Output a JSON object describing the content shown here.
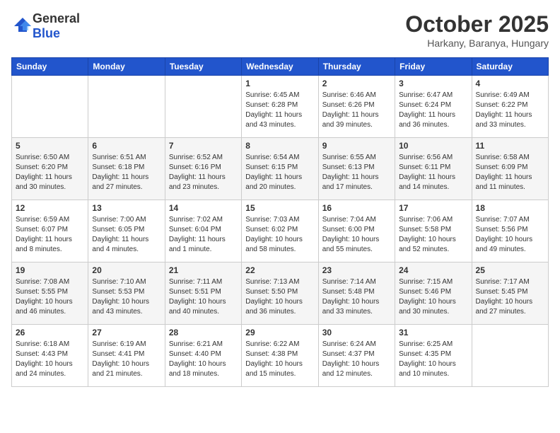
{
  "logo": {
    "general": "General",
    "blue": "Blue"
  },
  "header": {
    "title": "October 2025",
    "subtitle": "Harkany, Baranya, Hungary"
  },
  "weekdays": [
    "Sunday",
    "Monday",
    "Tuesday",
    "Wednesday",
    "Thursday",
    "Friday",
    "Saturday"
  ],
  "weeks": [
    [
      {
        "day": "",
        "info": ""
      },
      {
        "day": "",
        "info": ""
      },
      {
        "day": "",
        "info": ""
      },
      {
        "day": "1",
        "info": "Sunrise: 6:45 AM\nSunset: 6:28 PM\nDaylight: 11 hours\nand 43 minutes."
      },
      {
        "day": "2",
        "info": "Sunrise: 6:46 AM\nSunset: 6:26 PM\nDaylight: 11 hours\nand 39 minutes."
      },
      {
        "day": "3",
        "info": "Sunrise: 6:47 AM\nSunset: 6:24 PM\nDaylight: 11 hours\nand 36 minutes."
      },
      {
        "day": "4",
        "info": "Sunrise: 6:49 AM\nSunset: 6:22 PM\nDaylight: 11 hours\nand 33 minutes."
      }
    ],
    [
      {
        "day": "5",
        "info": "Sunrise: 6:50 AM\nSunset: 6:20 PM\nDaylight: 11 hours\nand 30 minutes."
      },
      {
        "day": "6",
        "info": "Sunrise: 6:51 AM\nSunset: 6:18 PM\nDaylight: 11 hours\nand 27 minutes."
      },
      {
        "day": "7",
        "info": "Sunrise: 6:52 AM\nSunset: 6:16 PM\nDaylight: 11 hours\nand 23 minutes."
      },
      {
        "day": "8",
        "info": "Sunrise: 6:54 AM\nSunset: 6:15 PM\nDaylight: 11 hours\nand 20 minutes."
      },
      {
        "day": "9",
        "info": "Sunrise: 6:55 AM\nSunset: 6:13 PM\nDaylight: 11 hours\nand 17 minutes."
      },
      {
        "day": "10",
        "info": "Sunrise: 6:56 AM\nSunset: 6:11 PM\nDaylight: 11 hours\nand 14 minutes."
      },
      {
        "day": "11",
        "info": "Sunrise: 6:58 AM\nSunset: 6:09 PM\nDaylight: 11 hours\nand 11 minutes."
      }
    ],
    [
      {
        "day": "12",
        "info": "Sunrise: 6:59 AM\nSunset: 6:07 PM\nDaylight: 11 hours\nand 8 minutes."
      },
      {
        "day": "13",
        "info": "Sunrise: 7:00 AM\nSunset: 6:05 PM\nDaylight: 11 hours\nand 4 minutes."
      },
      {
        "day": "14",
        "info": "Sunrise: 7:02 AM\nSunset: 6:04 PM\nDaylight: 11 hours\nand 1 minute."
      },
      {
        "day": "15",
        "info": "Sunrise: 7:03 AM\nSunset: 6:02 PM\nDaylight: 10 hours\nand 58 minutes."
      },
      {
        "day": "16",
        "info": "Sunrise: 7:04 AM\nSunset: 6:00 PM\nDaylight: 10 hours\nand 55 minutes."
      },
      {
        "day": "17",
        "info": "Sunrise: 7:06 AM\nSunset: 5:58 PM\nDaylight: 10 hours\nand 52 minutes."
      },
      {
        "day": "18",
        "info": "Sunrise: 7:07 AM\nSunset: 5:56 PM\nDaylight: 10 hours\nand 49 minutes."
      }
    ],
    [
      {
        "day": "19",
        "info": "Sunrise: 7:08 AM\nSunset: 5:55 PM\nDaylight: 10 hours\nand 46 minutes."
      },
      {
        "day": "20",
        "info": "Sunrise: 7:10 AM\nSunset: 5:53 PM\nDaylight: 10 hours\nand 43 minutes."
      },
      {
        "day": "21",
        "info": "Sunrise: 7:11 AM\nSunset: 5:51 PM\nDaylight: 10 hours\nand 40 minutes."
      },
      {
        "day": "22",
        "info": "Sunrise: 7:13 AM\nSunset: 5:50 PM\nDaylight: 10 hours\nand 36 minutes."
      },
      {
        "day": "23",
        "info": "Sunrise: 7:14 AM\nSunset: 5:48 PM\nDaylight: 10 hours\nand 33 minutes."
      },
      {
        "day": "24",
        "info": "Sunrise: 7:15 AM\nSunset: 5:46 PM\nDaylight: 10 hours\nand 30 minutes."
      },
      {
        "day": "25",
        "info": "Sunrise: 7:17 AM\nSunset: 5:45 PM\nDaylight: 10 hours\nand 27 minutes."
      }
    ],
    [
      {
        "day": "26",
        "info": "Sunrise: 6:18 AM\nSunset: 4:43 PM\nDaylight: 10 hours\nand 24 minutes."
      },
      {
        "day": "27",
        "info": "Sunrise: 6:19 AM\nSunset: 4:41 PM\nDaylight: 10 hours\nand 21 minutes."
      },
      {
        "day": "28",
        "info": "Sunrise: 6:21 AM\nSunset: 4:40 PM\nDaylight: 10 hours\nand 18 minutes."
      },
      {
        "day": "29",
        "info": "Sunrise: 6:22 AM\nSunset: 4:38 PM\nDaylight: 10 hours\nand 15 minutes."
      },
      {
        "day": "30",
        "info": "Sunrise: 6:24 AM\nSunset: 4:37 PM\nDaylight: 10 hours\nand 12 minutes."
      },
      {
        "day": "31",
        "info": "Sunrise: 6:25 AM\nSunset: 4:35 PM\nDaylight: 10 hours\nand 10 minutes."
      },
      {
        "day": "",
        "info": ""
      }
    ]
  ]
}
